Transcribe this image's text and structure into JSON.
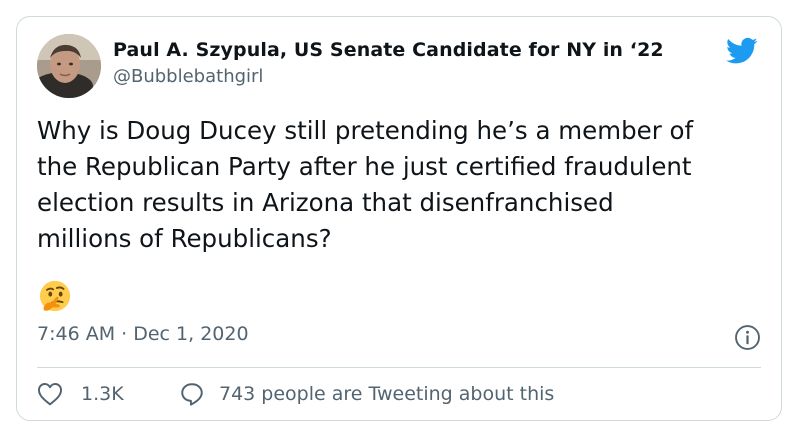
{
  "tweet": {
    "author_name": "Paul A. Szypula, US Senate Candidate for NY in ‘22",
    "handle": "@Bubblebathgirl",
    "text": "Why is Doug Ducey still pretending he’s a member of\nthe Republican Party after he just certified fraudulent\nelection results in Arizona that disenfranchised\nmillions of Republicans?",
    "emoji": "thinking-face",
    "timestamp": "7:46 AM · Dec 1, 2020",
    "likes": "1.3K",
    "reply_text": "743 people are Tweeting about this",
    "icons": {
      "brand": "twitter-bird-icon",
      "info": "info-icon",
      "like": "heart-icon",
      "reply": "speech-bubble-icon"
    }
  },
  "colors": {
    "brand": "#1d9bf0",
    "text": "#0f1419",
    "secondary": "#536471",
    "border": "#cfd9de"
  }
}
